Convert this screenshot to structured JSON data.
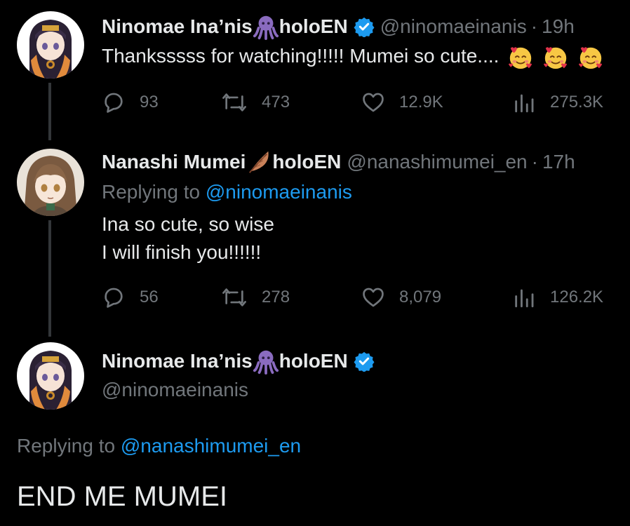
{
  "tweets": [
    {
      "display_name": "Ninomae Ina’nis",
      "name_suffix": "holoEN",
      "name_emoji": "octopus-emoji",
      "verified": true,
      "handle": "@ninomaeinanis",
      "time": "19h",
      "text": "Thanksssss for watching!!!!! Mumei so cute....",
      "text_emojis": [
        "smiling-face-with-hearts-emoji",
        "smiling-face-with-hearts-emoji",
        "smiling-face-with-hearts-emoji"
      ],
      "replies": "93",
      "retweets": "473",
      "likes": "12.9K",
      "views": "275.3K"
    },
    {
      "display_name": "Nanashi Mumei",
      "name_suffix": "holoEN",
      "name_emoji": "feather-emoji",
      "verified": false,
      "handle": "@nanashimumei_en",
      "time": "17h",
      "replying_label": "Replying to",
      "replying_handle": "@ninomaeinanis",
      "text_lines": [
        "Ina so cute, so wise",
        "I will finish you!!!!!!"
      ],
      "replies": "56",
      "retweets": "278",
      "likes": "8,079",
      "views": "126.2K"
    },
    {
      "display_name": "Ninomae Ina’nis",
      "name_suffix": "holoEN",
      "name_emoji": "octopus-emoji",
      "verified": true,
      "handle": "@ninomaeinanis",
      "replying_label": "Replying to",
      "replying_handle": "@nanashimumei_en",
      "text": "END ME MUMEI"
    }
  ],
  "colors": {
    "background": "#000000",
    "text": "#e7e9ea",
    "secondary": "#71767b",
    "link": "#1d9bf0",
    "thread_line": "#333639",
    "verified": "#1d9bf0",
    "octopus": "#8a6bbf"
  }
}
